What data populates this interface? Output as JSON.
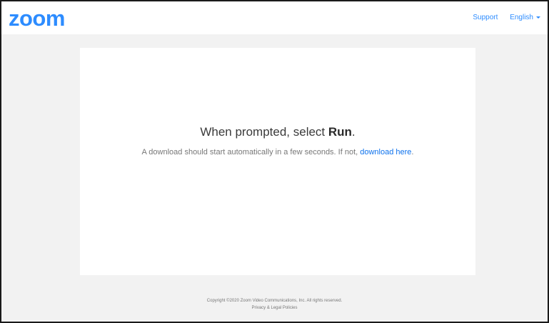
{
  "header": {
    "logo_text": "zoom",
    "support_label": "Support",
    "language_label": "English"
  },
  "main": {
    "headline_prefix": "When prompted, select ",
    "headline_action": "Run",
    "headline_suffix": ".",
    "subline_text": "A download should start automatically in a few seconds. If not, ",
    "download_link_label": "download here",
    "subline_suffix": "."
  },
  "footer": {
    "copyright": "Copyright ©2020 Zoom Video Communications, Inc. All rights reserved.",
    "privacy_link": "Privacy & Legal Policies"
  },
  "colors": {
    "brand": "#2d8cff",
    "link": "#0e72ed",
    "background": "#f2f2f2"
  },
  "icons": {
    "language_dropdown": "caret-down-icon"
  }
}
